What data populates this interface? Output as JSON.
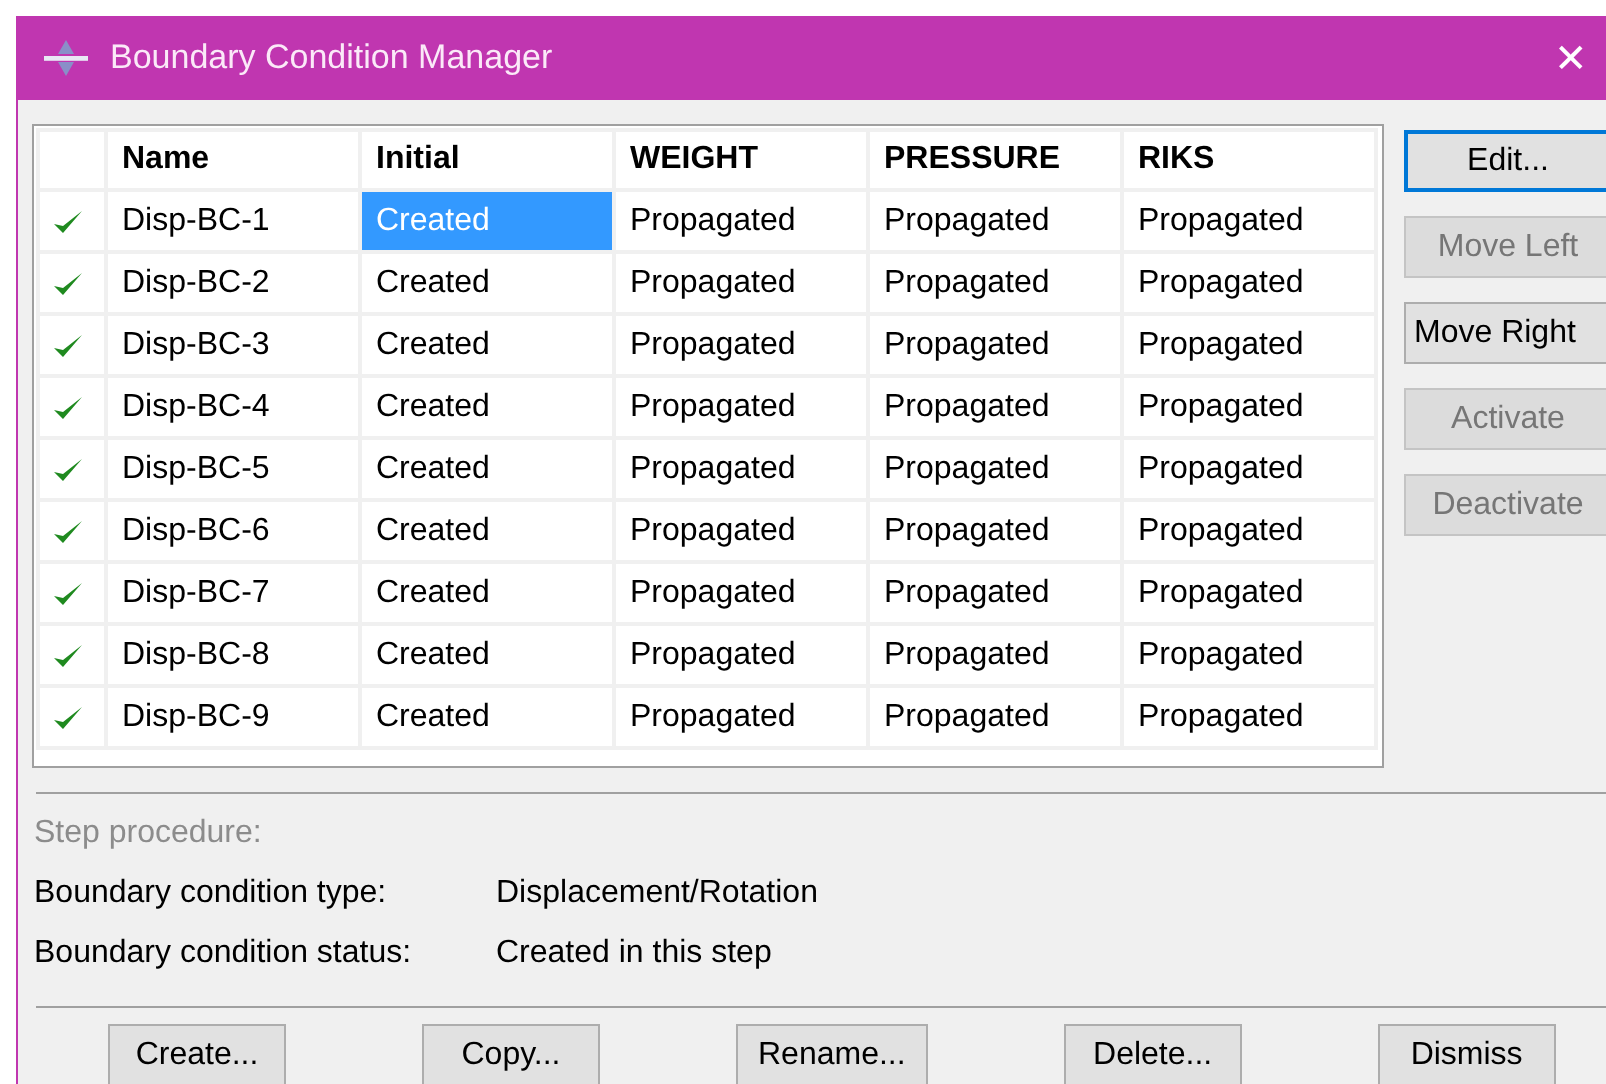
{
  "window": {
    "title": "Boundary Condition Manager",
    "close": "✕"
  },
  "table": {
    "columns": [
      "Name",
      "Initial",
      "WEIGHT",
      "PRESSURE",
      "RIKS"
    ],
    "rows": [
      {
        "active": true,
        "cells": [
          {
            "text": "Disp-BC-1",
            "selected": false
          },
          {
            "text": "Created",
            "selected": true
          },
          {
            "text": "Propagated",
            "selected": false
          },
          {
            "text": "Propagated",
            "selected": false
          },
          {
            "text": "Propagated",
            "selected": false
          }
        ]
      },
      {
        "active": true,
        "cells": [
          {
            "text": "Disp-BC-2",
            "selected": false
          },
          {
            "text": "Created",
            "selected": false
          },
          {
            "text": "Propagated",
            "selected": false
          },
          {
            "text": "Propagated",
            "selected": false
          },
          {
            "text": "Propagated",
            "selected": false
          }
        ]
      },
      {
        "active": true,
        "cells": [
          {
            "text": "Disp-BC-3",
            "selected": false
          },
          {
            "text": "Created",
            "selected": false
          },
          {
            "text": "Propagated",
            "selected": false
          },
          {
            "text": "Propagated",
            "selected": false
          },
          {
            "text": "Propagated",
            "selected": false
          }
        ]
      },
      {
        "active": true,
        "cells": [
          {
            "text": "Disp-BC-4",
            "selected": false
          },
          {
            "text": "Created",
            "selected": false
          },
          {
            "text": "Propagated",
            "selected": false
          },
          {
            "text": "Propagated",
            "selected": false
          },
          {
            "text": "Propagated",
            "selected": false
          }
        ]
      },
      {
        "active": true,
        "cells": [
          {
            "text": "Disp-BC-5",
            "selected": false
          },
          {
            "text": "Created",
            "selected": false
          },
          {
            "text": "Propagated",
            "selected": false
          },
          {
            "text": "Propagated",
            "selected": false
          },
          {
            "text": "Propagated",
            "selected": false
          }
        ]
      },
      {
        "active": true,
        "cells": [
          {
            "text": "Disp-BC-6",
            "selected": false
          },
          {
            "text": "Created",
            "selected": false
          },
          {
            "text": "Propagated",
            "selected": false
          },
          {
            "text": "Propagated",
            "selected": false
          },
          {
            "text": "Propagated",
            "selected": false
          }
        ]
      },
      {
        "active": true,
        "cells": [
          {
            "text": "Disp-BC-7",
            "selected": false
          },
          {
            "text": "Created",
            "selected": false
          },
          {
            "text": "Propagated",
            "selected": false
          },
          {
            "text": "Propagated",
            "selected": false
          },
          {
            "text": "Propagated",
            "selected": false
          }
        ]
      },
      {
        "active": true,
        "cells": [
          {
            "text": "Disp-BC-8",
            "selected": false
          },
          {
            "text": "Created",
            "selected": false
          },
          {
            "text": "Propagated",
            "selected": false
          },
          {
            "text": "Propagated",
            "selected": false
          },
          {
            "text": "Propagated",
            "selected": false
          }
        ]
      },
      {
        "active": true,
        "cells": [
          {
            "text": "Disp-BC-9",
            "selected": false
          },
          {
            "text": "Created",
            "selected": false
          },
          {
            "text": "Propagated",
            "selected": false
          },
          {
            "text": "Propagated",
            "selected": false
          },
          {
            "text": "Propagated",
            "selected": false
          }
        ]
      }
    ]
  },
  "side_buttons": [
    {
      "label": "Edit...",
      "disabled": false,
      "focused": true
    },
    {
      "label": "Move Left",
      "disabled": true,
      "focused": false
    },
    {
      "label": "Move Right",
      "disabled": false,
      "focused": false
    },
    {
      "label": "Activate",
      "disabled": true,
      "focused": false
    },
    {
      "label": "Deactivate",
      "disabled": true,
      "focused": false
    }
  ],
  "info": [
    {
      "label": "Step procedure:",
      "disabled": true
    },
    {
      "label": "Boundary condition type:",
      "value": "Displacement/Rotation",
      "disabled": false
    },
    {
      "label": "Boundary condition status:",
      "value": "Created in this step",
      "disabled": false
    }
  ],
  "buttons": [
    "Create...",
    "Copy...",
    "Rename...",
    "Delete...",
    "Dismiss"
  ]
}
